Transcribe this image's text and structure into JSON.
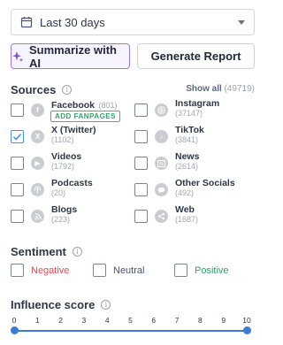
{
  "date_filter": {
    "value": "Last 30 days"
  },
  "buttons": {
    "summarize": "Summarize with AI",
    "report": "Generate Report"
  },
  "sources": {
    "title": "Sources",
    "show_all": "Show all",
    "show_all_count": "(49719)",
    "fanpages_label": "ADD FANPAGES",
    "items": [
      {
        "name": "Facebook",
        "count": "(801)",
        "checked": false,
        "icon": "facebook-icon"
      },
      {
        "name": "Instagram",
        "count": "(37147)",
        "checked": false,
        "icon": "instagram-icon"
      },
      {
        "name": "X (Twitter)",
        "count": "(1102)",
        "checked": true,
        "icon": "x-icon"
      },
      {
        "name": "TikTok",
        "count": "(3841)",
        "checked": false,
        "icon": "tiktok-icon"
      },
      {
        "name": "Videos",
        "count": "(1792)",
        "checked": false,
        "icon": "play-icon"
      },
      {
        "name": "News",
        "count": "(2614)",
        "checked": false,
        "icon": "news-icon"
      },
      {
        "name": "Podcasts",
        "count": "(20)",
        "checked": false,
        "icon": "podcast-icon"
      },
      {
        "name": "Other Socials",
        "count": "(492)",
        "checked": false,
        "icon": "chat-icon"
      },
      {
        "name": "Blogs",
        "count": "(223)",
        "checked": false,
        "icon": "rss-icon"
      },
      {
        "name": "Web",
        "count": "(1687)",
        "checked": false,
        "icon": "share-icon"
      }
    ]
  },
  "sentiment": {
    "title": "Sentiment",
    "options": [
      {
        "label": "Negative",
        "color": "#e04b5a"
      },
      {
        "label": "Neutral",
        "color": "#4a5568"
      },
      {
        "label": "Positive",
        "color": "#2ea66b"
      }
    ]
  },
  "influence": {
    "title": "Influence score",
    "scale": [
      "0",
      "1",
      "2",
      "3",
      "4",
      "5",
      "6",
      "7",
      "8",
      "9",
      "10"
    ],
    "range": [
      0,
      10
    ]
  }
}
